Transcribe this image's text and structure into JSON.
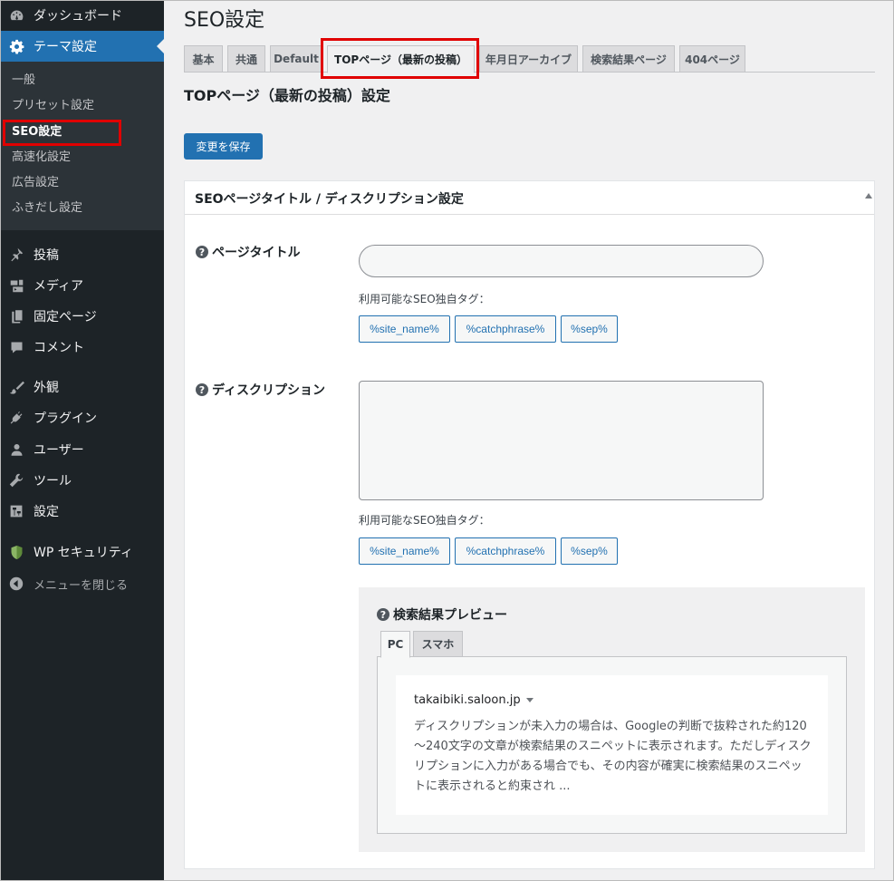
{
  "sidebar": {
    "items": [
      {
        "label": "ダッシュボード",
        "icon": "dashboard-icon"
      },
      {
        "label": "テーマ設定",
        "icon": "gear-icon"
      },
      {
        "label": "投稿",
        "icon": "pin-icon"
      },
      {
        "label": "メディア",
        "icon": "media-icon"
      },
      {
        "label": "固定ページ",
        "icon": "page-icon"
      },
      {
        "label": "コメント",
        "icon": "comment-icon"
      },
      {
        "label": "外観",
        "icon": "brush-icon"
      },
      {
        "label": "プラグイン",
        "icon": "plug-icon"
      },
      {
        "label": "ユーザー",
        "icon": "user-icon"
      },
      {
        "label": "ツール",
        "icon": "wrench-icon"
      },
      {
        "label": "設定",
        "icon": "settings-icon"
      },
      {
        "label": "WP セキュリティ",
        "icon": "shield-icon"
      }
    ],
    "submenu": [
      "一般",
      "プリセット設定",
      "SEO設定",
      "高速化設定",
      "広告設定",
      "ふきだし設定"
    ],
    "collapse_label": "メニューを閉じる"
  },
  "page": {
    "title": "SEO設定",
    "tabs": [
      "基本",
      "共通",
      "Default",
      "TOPページ（最新の投稿）",
      "年月日アーカイブ",
      "検索結果ページ",
      "404ページ"
    ],
    "section_title": "TOPページ（最新の投稿）設定",
    "save_label": "変更を保存"
  },
  "postbox": {
    "title": "SEOページタイトル / ディスクリプション設定",
    "page_title_label": "ページタイトル",
    "description_label": "ディスクリプション",
    "tags_label": "利用可能なSEO独自タグ：",
    "tags": [
      "%site_name%",
      "%catchphrase%",
      "%sep%"
    ],
    "page_title_value": "",
    "description_value": ""
  },
  "preview": {
    "title": "検索結果プレビュー",
    "tabs": [
      "PC",
      "スマホ"
    ],
    "url": "takaibiki.saloon.jp",
    "description": "ディスクリプションが未入力の場合は、Googleの判断で抜粋された約120～240文字の文章が検索結果のスニペットに表示されます。ただしディスクリプションに入力がある場合でも、その内容が確実に検索結果のスニペットに表示されると約束され ..."
  },
  "colors": {
    "sidebar_bg": "#1d2327",
    "accent": "#2271b1",
    "highlight": "#e00000"
  }
}
